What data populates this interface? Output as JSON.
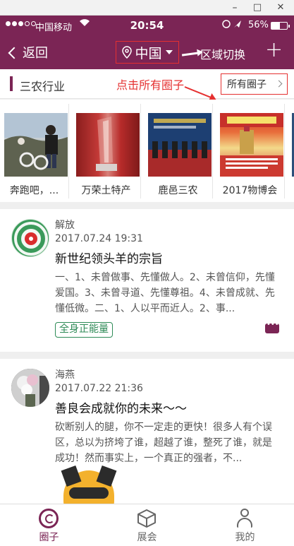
{
  "window": {
    "minimize": "–",
    "maximize": "□",
    "close": "✕"
  },
  "status_bar": {
    "carrier": "中国移动",
    "time": "20:54",
    "battery": "56%",
    "battery_level": 0.56
  },
  "navbar": {
    "back_label": "返回",
    "region": "中国",
    "switch_hint": "区域切换",
    "add_symbol": "+"
  },
  "section": {
    "title": "三农行业",
    "hint": "点击所有圈子",
    "all_label": "所有圈子"
  },
  "carousel": [
    {
      "label": "奔跑吧，..."
    },
    {
      "label": "万荣土特产"
    },
    {
      "label": "鹿邑三农"
    },
    {
      "label": "2017物博会"
    },
    {
      "label": ""
    }
  ],
  "posts": [
    {
      "author": "解放",
      "date": "2017.07.24 19:31",
      "title": "新世纪领头羊的宗旨",
      "body": "一、1、未曾做事、先懂做人。2、未曾信仰，先懂爱国。3、未曾寻道、先懂尊祖。4、未曾成就、先懂低微。二、1、人以平而近人。2、事...",
      "tag": "全身正能量"
    },
    {
      "author": "海燕",
      "date": "2017.07.22 21:36",
      "title": "善良会成就你的未来～～",
      "body": "砍断别人的腿，你不一定走的更快！很多人有个误区，总以为挤垮了谁，超越了谁，整死了谁，就是成功！然而事实上，一个真正的强者，不..."
    }
  ],
  "tabs": [
    {
      "label": "圈子",
      "icon": "circle-icon",
      "active": true
    },
    {
      "label": "展会",
      "icon": "box-icon",
      "active": false
    },
    {
      "label": "我的",
      "icon": "person-icon",
      "active": false
    }
  ],
  "colors": {
    "brand": "#7b2555",
    "annotation": "#e53030",
    "tag": "#2e8b57"
  }
}
